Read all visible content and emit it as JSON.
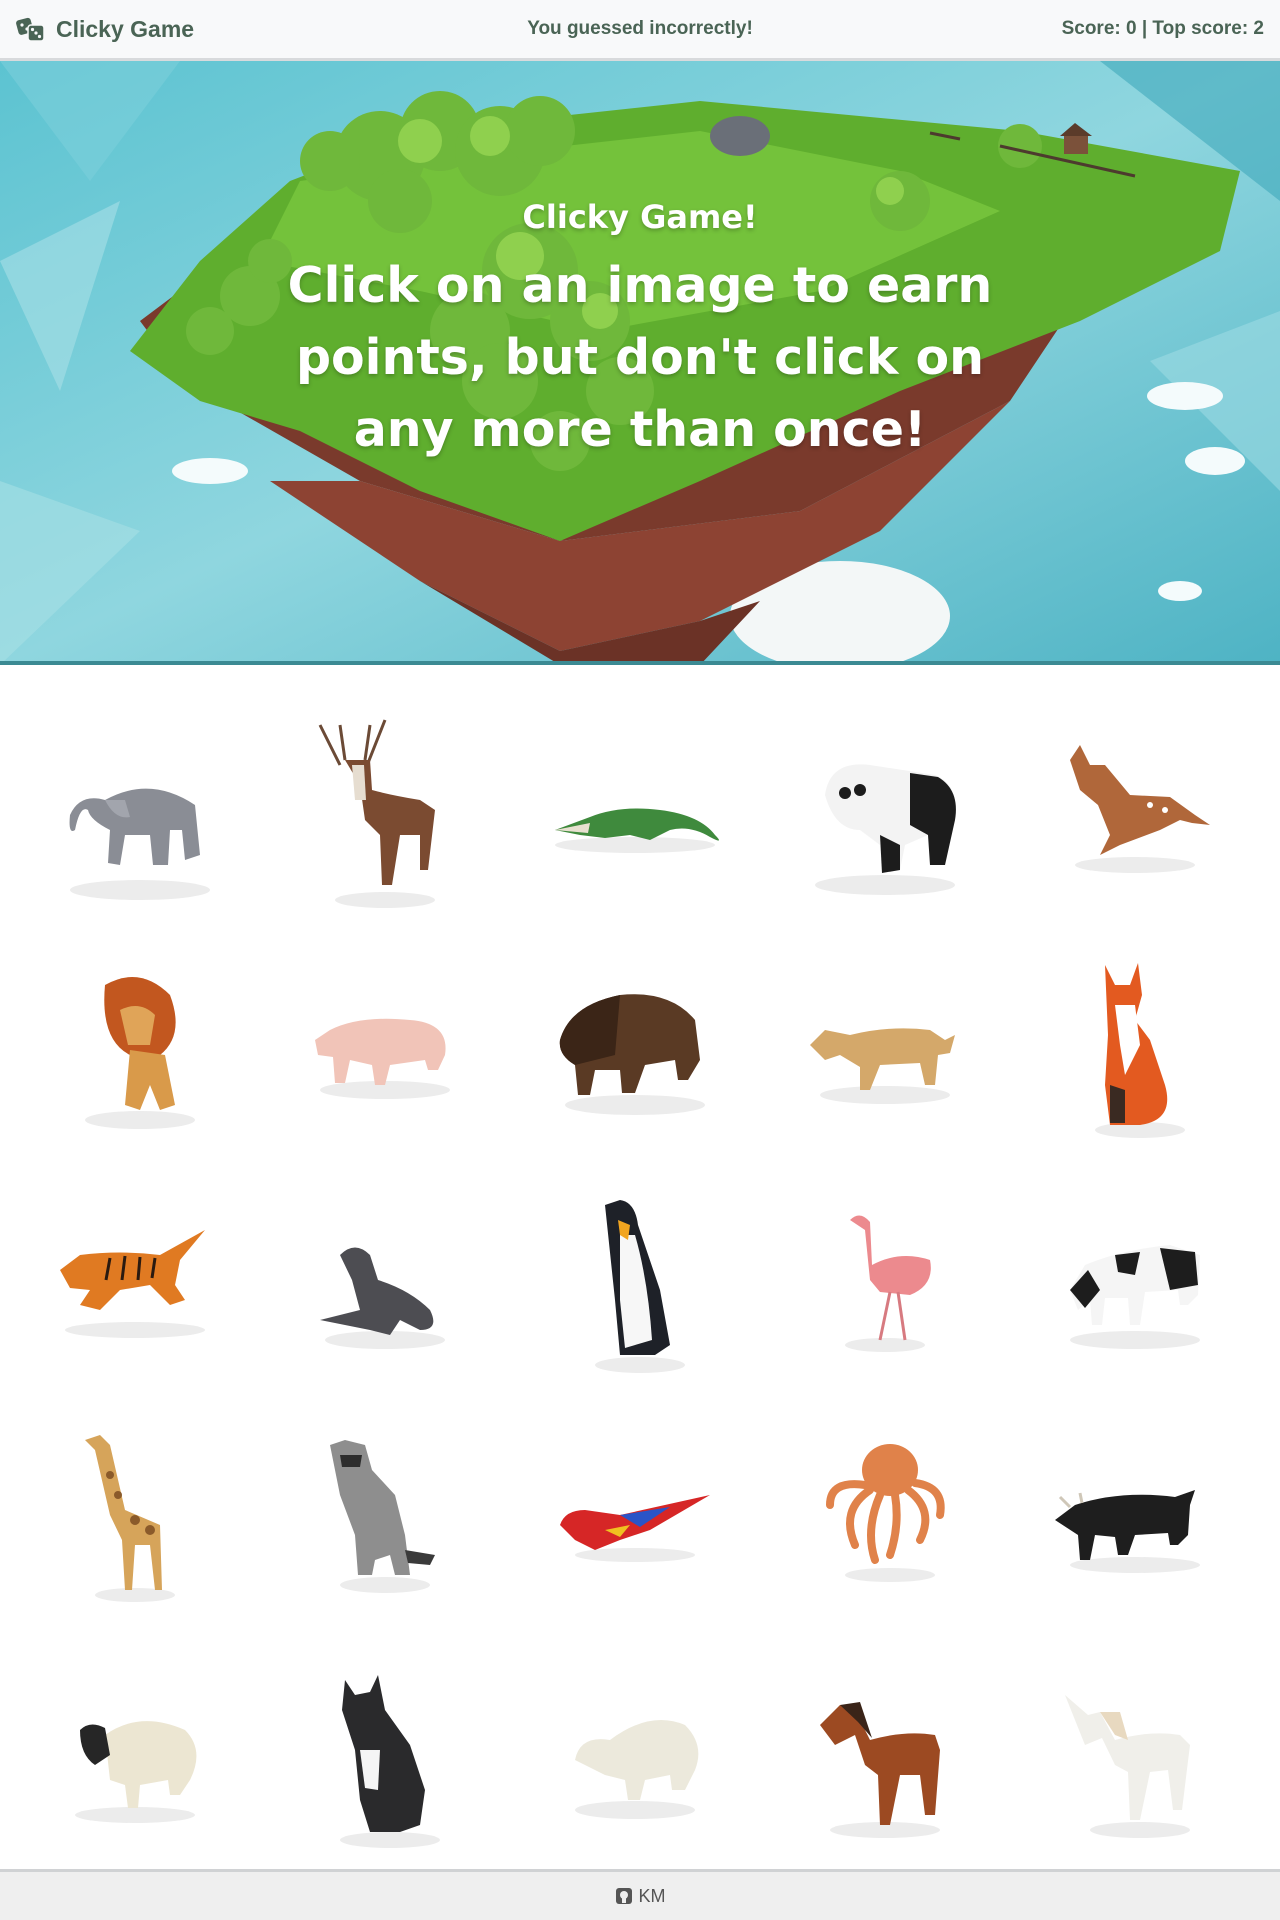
{
  "navbar": {
    "brand": "Clicky Game",
    "brand_icon": "dice-icon",
    "message": "You guessed incorrectly!",
    "score_text": "Score: 0 | Top score: 2"
  },
  "hero": {
    "title": "Clicky Game!",
    "subtitle": "Click on an image to earn points, but don't click on any more than once!"
  },
  "cards": [
    {
      "animal": "elephant"
    },
    {
      "animal": "deer"
    },
    {
      "animal": "crocodile"
    },
    {
      "animal": "panda"
    },
    {
      "animal": "fawn"
    },
    {
      "animal": "lion"
    },
    {
      "animal": "pig"
    },
    {
      "animal": "bison"
    },
    {
      "animal": "lioness"
    },
    {
      "animal": "fox"
    },
    {
      "animal": "tiger"
    },
    {
      "animal": "seal"
    },
    {
      "animal": "penguin"
    },
    {
      "animal": "flamingo"
    },
    {
      "animal": "cow"
    },
    {
      "animal": "giraffe"
    },
    {
      "animal": "raccoon"
    },
    {
      "animal": "parrot"
    },
    {
      "animal": "octopus"
    },
    {
      "animal": "bull"
    },
    {
      "animal": "sheep"
    },
    {
      "animal": "cat"
    },
    {
      "animal": "polar-bear"
    },
    {
      "animal": "horse"
    },
    {
      "animal": "unicorn"
    }
  ],
  "footer": {
    "icon": "github-icon",
    "text": "KM"
  }
}
